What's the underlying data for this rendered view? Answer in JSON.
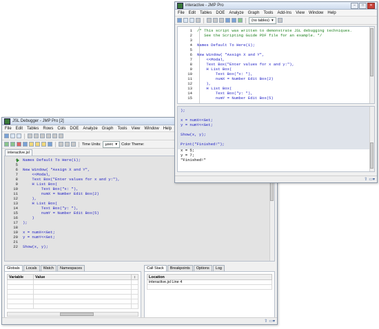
{
  "debugger": {
    "title": "JSL Debugger - JMP Pro [2]",
    "menu": [
      "File",
      "Edit",
      "Tables",
      "Rows",
      "Cols",
      "DOE",
      "Analyze",
      "Graph",
      "Tools",
      "View",
      "Window",
      "Help"
    ],
    "time_units_label": "Time Units:",
    "time_units_value": "µsec",
    "color_theme_label": "Color Theme:",
    "file_tab": "interactive.jsl",
    "code_lines": [
      {
        "n": "4",
        "t": "Names Default To Here(1);"
      },
      {
        "n": "5",
        "t": ""
      },
      {
        "n": "6",
        "t": "New Window( \"Assign X and Y\","
      },
      {
        "n": "7",
        "t": "    <<Modal,"
      },
      {
        "n": "8",
        "t": "    Text Box(\"Enter values for x and y:\"),"
      },
      {
        "n": "9",
        "t": "    H List Box("
      },
      {
        "n": "10",
        "t": "        Text Box(\"x: \"),"
      },
      {
        "n": "11",
        "t": "        numX = Number Edit Box(2)"
      },
      {
        "n": "12",
        "t": "    ),"
      },
      {
        "n": "13",
        "t": "    H List Box("
      },
      {
        "n": "14",
        "t": "        Text Box(\"y: \"),"
      },
      {
        "n": "15",
        "t": "        numY = Number Edit Box(5)"
      },
      {
        "n": "16",
        "t": "    )"
      },
      {
        "n": "17",
        "t": ");"
      },
      {
        "n": "18",
        "t": ""
      },
      {
        "n": "19",
        "t": "x = numX<<Get;"
      },
      {
        "n": "20",
        "t": "y = numY<<Get;"
      },
      {
        "n": "21",
        "t": ""
      },
      {
        "n": "22",
        "t": "Show(x, y);"
      }
    ],
    "left_tabs": [
      "Globals",
      "Locals",
      "Watch",
      "Namespaces"
    ],
    "var_headers": [
      "Variable",
      "Value"
    ],
    "right_tabs": [
      "Call Stack",
      "Breakpoints",
      "Options",
      "Log"
    ],
    "location_header": "Location",
    "location_row": "interactive.jsl Line 4"
  },
  "script_window": {
    "title": "interactive - JMP Pro",
    "menu": [
      "File",
      "Edit",
      "Tables",
      "DOE",
      "Analyze",
      "Graph",
      "Tools",
      "Add-Ins",
      "View",
      "Window",
      "Help"
    ],
    "table_combo": "(no tables)",
    "code_lines": [
      {
        "n": "1",
        "t": "/* This script was written to demonstrate JSL debugging techniques.",
        "c": true
      },
      {
        "n": "2",
        "t": "   See the Scripting Guide PDF file for an example. */",
        "c": true
      },
      {
        "n": "3",
        "t": ""
      },
      {
        "n": "4",
        "t": "Names Default To Here(1);"
      },
      {
        "n": "5",
        "t": ""
      },
      {
        "n": "6",
        "t": "New Window( \"Assign X and Y\","
      },
      {
        "n": "7",
        "t": "    <<Modal,"
      },
      {
        "n": "8",
        "t": "    Text Box(\"Enter values for x and y:\"),"
      },
      {
        "n": "9",
        "t": "    H List Box("
      },
      {
        "n": "10",
        "t": "        Text Box(\"x: \"),"
      },
      {
        "n": "11",
        "t": "        numX = Number Edit Box(2)"
      },
      {
        "n": "12",
        "t": "    ),"
      },
      {
        "n": "13",
        "t": "    H List Box("
      },
      {
        "n": "14",
        "t": "        Text Box(\"y: \"),"
      },
      {
        "n": "15",
        "t": "        numY = Number Edit Box(5)"
      }
    ],
    "log_lines": [
      ");",
      "",
      "x = numX<<Get;",
      "y = numY<<Get;",
      "",
      "Show(x, y);",
      "",
      "Print(\"Finished!\");"
    ],
    "output_lines": [
      "x = 5;",
      "y = 7;",
      "\"Finished!\""
    ]
  }
}
